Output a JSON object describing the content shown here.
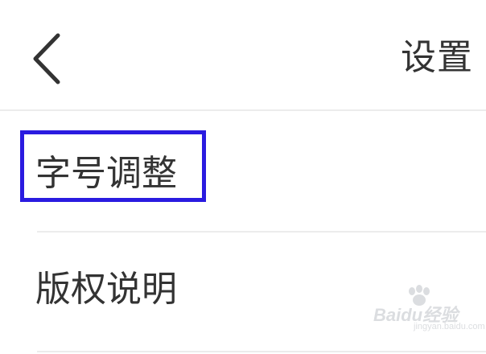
{
  "header": {
    "title": "设置",
    "back_icon": "chevron-left-icon"
  },
  "menu": {
    "items": [
      {
        "label": "字号调整",
        "highlighted": true
      },
      {
        "label": "版权说明",
        "highlighted": false
      }
    ]
  },
  "highlight": {
    "color": "#2a1be0"
  },
  "watermark": {
    "brand": "Baidu",
    "service": "经验",
    "site": "jingyan.baidu.com"
  }
}
